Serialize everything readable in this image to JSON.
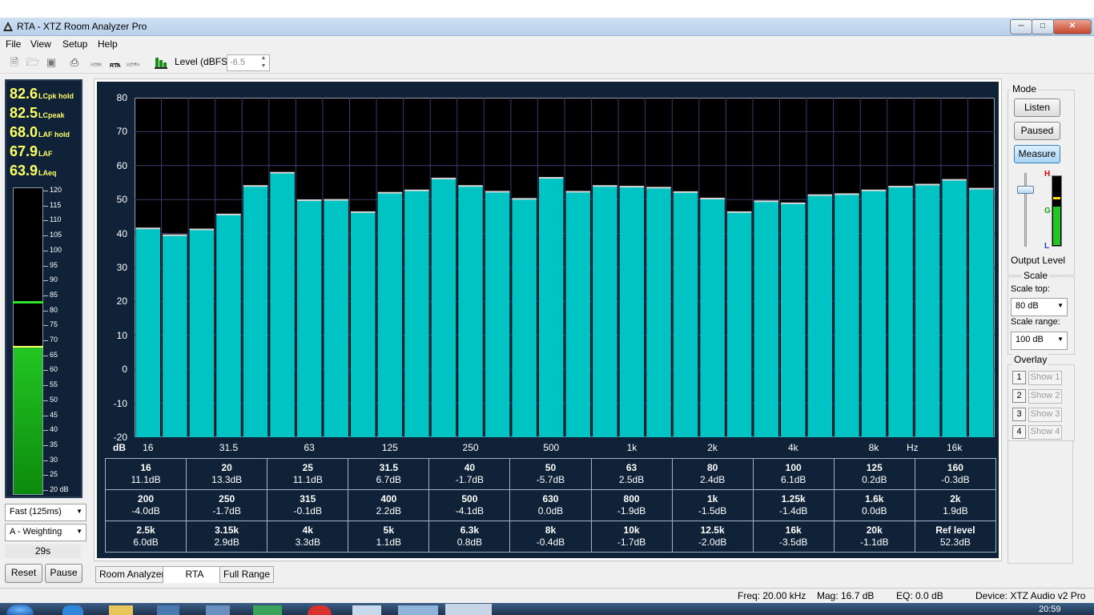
{
  "window": {
    "title": "RTA - XTZ Room Analyzer Pro"
  },
  "menu": [
    "File",
    "View",
    "Setup",
    "Help"
  ],
  "toolbar": {
    "room_label": "ROM",
    "rta_label": "RTA",
    "both_label": "BOTH",
    "level_label": "Level (dBFS)",
    "level_value": "-6.5"
  },
  "levels": [
    {
      "value": "82.6",
      "label": "LCpk hold"
    },
    {
      "value": "82.5",
      "label": "LCpeak"
    },
    {
      "value": "68.0",
      "label": "LAF hold"
    },
    {
      "value": "67.9",
      "label": "LAF"
    },
    {
      "value": "63.9",
      "label": "LAeq"
    }
  ],
  "meter": {
    "ticks": [
      "120",
      "115",
      "110",
      "105",
      "100",
      "95",
      "90",
      "85",
      "80",
      "75",
      "70",
      "65",
      "60",
      "55",
      "50",
      "45",
      "40",
      "35",
      "30",
      "25",
      "20 dB"
    ],
    "level_db": 67.9,
    "peak_hold_db": 82.6,
    "min_db": 20,
    "max_db": 120
  },
  "left_controls": {
    "speed": "Fast (125ms)",
    "weighting": "A - Weighting",
    "elapsed": "29s",
    "reset": "Reset",
    "pause": "Pause"
  },
  "mode": {
    "title": "Mode",
    "listen": "Listen",
    "paused": "Paused",
    "measure": "Measure",
    "output_level": "Output Level",
    "h": "H",
    "g": "G",
    "l": "L"
  },
  "scale": {
    "title": "Scale",
    "top_label": "Scale top:",
    "top_value": "80 dB",
    "range_label": "Scale range:",
    "range_value": "100 dB"
  },
  "overlay": {
    "title": "Overlay",
    "items": [
      {
        "num": "1",
        "label": "Show 1"
      },
      {
        "num": "2",
        "label": "Show 2"
      },
      {
        "num": "3",
        "label": "Show 3"
      },
      {
        "num": "4",
        "label": "Show 4"
      }
    ]
  },
  "chart_data": {
    "type": "bar",
    "ylim": [
      -20,
      80
    ],
    "yticks": [
      "80",
      "70",
      "60",
      "50",
      "40",
      "30",
      "20",
      "10",
      "0",
      "-10",
      "-20"
    ],
    "xunit_left": "dB",
    "xunit_right": "Hz",
    "xticks": [
      "16",
      "31.5",
      "63",
      "125",
      "250",
      "500",
      "1k",
      "2k",
      "4k",
      "8k",
      "16k"
    ],
    "categories": [
      "16",
      "20",
      "25",
      "31.5",
      "40",
      "50",
      "63",
      "80",
      "100",
      "125",
      "160",
      "200",
      "250",
      "315",
      "400",
      "500",
      "630",
      "800",
      "1k",
      "1.25k",
      "1.6k",
      "2k",
      "2.5k",
      "3.15k",
      "4k",
      "5k",
      "6.3k",
      "8k",
      "10k",
      "12.5k",
      "16k",
      "20k"
    ],
    "values": [
      41.5,
      39.5,
      41.2,
      45.6,
      54.0,
      57.9,
      49.8,
      49.9,
      46.3,
      52.0,
      52.7,
      56.2,
      54.0,
      52.3,
      50.2,
      56.4,
      52.3,
      54.0,
      53.8,
      53.5,
      52.2,
      50.3,
      46.3,
      49.5,
      48.9,
      51.3,
      51.6,
      52.7,
      53.8,
      54.4,
      55.8,
      53.2
    ],
    "grid": true
  },
  "bands_table": [
    [
      {
        "f": "16",
        "v": "11.1dB"
      },
      {
        "f": "20",
        "v": "13.3dB"
      },
      {
        "f": "25",
        "v": "11.1dB"
      },
      {
        "f": "31.5",
        "v": "6.7dB"
      },
      {
        "f": "40",
        "v": "-1.7dB"
      },
      {
        "f": "50",
        "v": "-5.7dB"
      },
      {
        "f": "63",
        "v": "2.5dB"
      },
      {
        "f": "80",
        "v": "2.4dB"
      },
      {
        "f": "100",
        "v": "6.1dB"
      },
      {
        "f": "125",
        "v": "0.2dB"
      },
      {
        "f": "160",
        "v": "-0.3dB"
      }
    ],
    [
      {
        "f": "200",
        "v": "-4.0dB"
      },
      {
        "f": "250",
        "v": "-1.7dB"
      },
      {
        "f": "315",
        "v": "-0.1dB"
      },
      {
        "f": "400",
        "v": "2.2dB"
      },
      {
        "f": "500",
        "v": "-4.1dB"
      },
      {
        "f": "630",
        "v": "0.0dB"
      },
      {
        "f": "800",
        "v": "-1.9dB"
      },
      {
        "f": "1k",
        "v": "-1.5dB"
      },
      {
        "f": "1.25k",
        "v": "-1.4dB"
      },
      {
        "f": "1.6k",
        "v": "0.0dB"
      },
      {
        "f": "2k",
        "v": "1.9dB"
      }
    ],
    [
      {
        "f": "2.5k",
        "v": "6.0dB"
      },
      {
        "f": "3.15k",
        "v": "2.9dB"
      },
      {
        "f": "4k",
        "v": "3.3dB"
      },
      {
        "f": "5k",
        "v": "1.1dB"
      },
      {
        "f": "6.3k",
        "v": "0.8dB"
      },
      {
        "f": "8k",
        "v": "-0.4dB"
      },
      {
        "f": "10k",
        "v": "-1.7dB"
      },
      {
        "f": "12.5k",
        "v": "-2.0dB"
      },
      {
        "f": "16k",
        "v": "-3.5dB"
      },
      {
        "f": "20k",
        "v": "-1.1dB"
      },
      {
        "f": "Ref level",
        "v": "52.3dB"
      }
    ]
  ],
  "tabs": [
    "Room Analyzer",
    "RTA",
    "Full Range"
  ],
  "status": {
    "freq": "Freq: 20.00 kHz",
    "mag": "Mag: 16.7 dB",
    "eq": "EQ: 0.0 dB",
    "device": "Device: XTZ Audio v2 Pro"
  },
  "taskbar": {
    "clock": "20:59"
  },
  "colors": {
    "bar": "#00c4c4",
    "plot_bg": "#000000",
    "frame_bg": "#0f2238",
    "level_text": "#ffff66"
  }
}
